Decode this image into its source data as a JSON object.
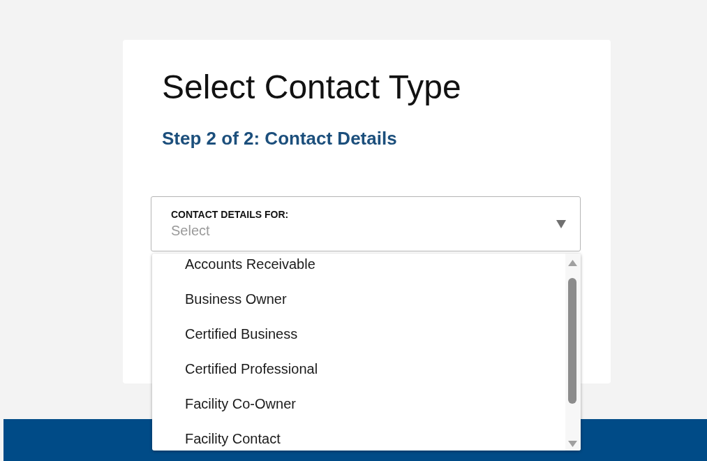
{
  "card": {
    "title": "Select Contact Type",
    "step": "Step 2 of 2: Contact Details"
  },
  "dropdown": {
    "label": "CONTACT DETAILS FOR:",
    "placeholder": "Select",
    "expanded": true,
    "options": [
      {
        "label": "Accounts Receivable"
      },
      {
        "label": "Business Owner"
      },
      {
        "label": "Certified Business"
      },
      {
        "label": "Certified Professional"
      },
      {
        "label": "Facility Co-Owner"
      },
      {
        "label": "Facility Contact"
      }
    ]
  }
}
